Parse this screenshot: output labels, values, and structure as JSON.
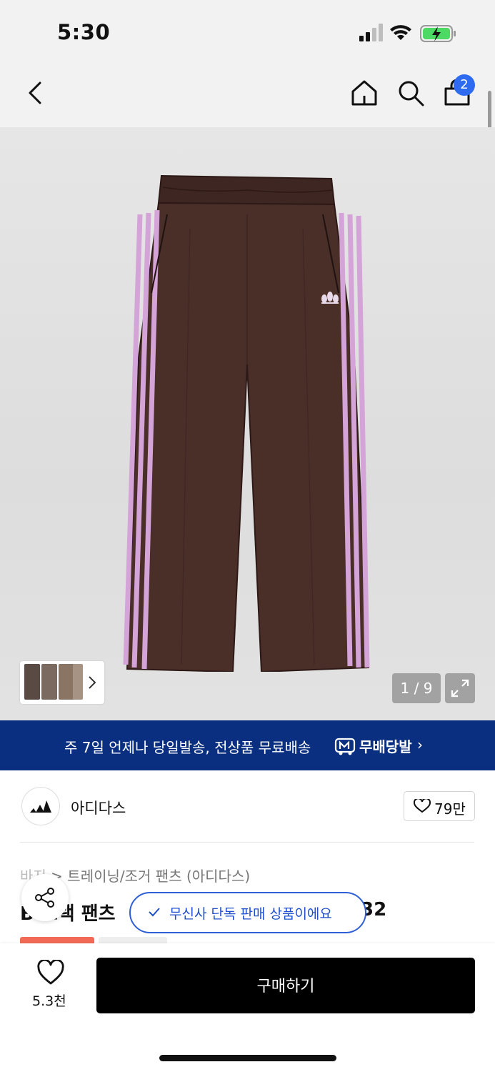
{
  "status_bar": {
    "time": "5:30"
  },
  "nav": {
    "cart_count": "2"
  },
  "gallery": {
    "counter": "1 / 9"
  },
  "delivery_banner": {
    "text": "주 7일 언제나 당일발송, 전상품 무료배송",
    "logo_text": "무배당발",
    "chevron": "›",
    "background_color": "#0a2f80"
  },
  "brand": {
    "name": "아디다스",
    "likes": "79만"
  },
  "product": {
    "breadcrumb_part1": "바지",
    "breadcrumb_sep": " > ",
    "breadcrumb_part2": "트레이닝/조거 팬츠 (아디다스)",
    "title_left": "B 트랙 팬츠",
    "title_right": "32"
  },
  "exclusive_badge": {
    "text": "무신사 단독 판매 상품이에요"
  },
  "bottom_bar": {
    "like_count": "5.3천",
    "buy_label": "구매하기"
  },
  "colors": {
    "accent_blue": "#2f6bf0",
    "buy_button": "#000000",
    "sale_tag": "#f26a55"
  }
}
